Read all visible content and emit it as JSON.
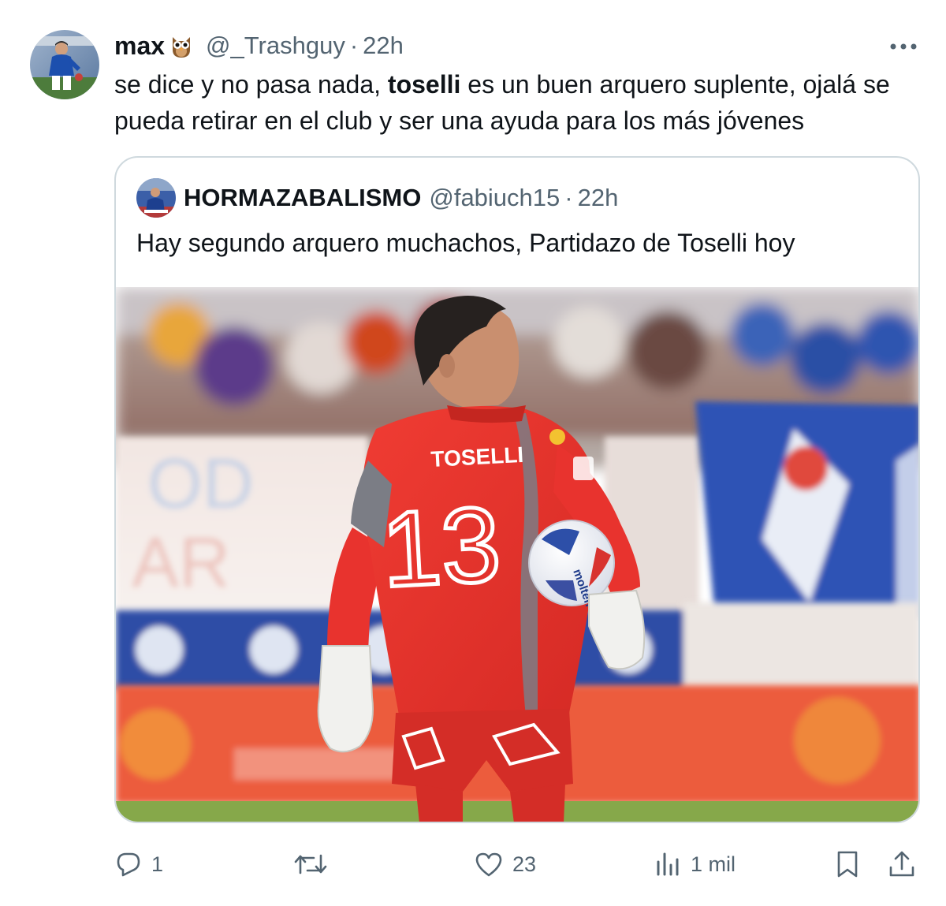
{
  "tweet": {
    "author_name": "max",
    "author_emoji": "owl-emoji",
    "handle": "@_Trashguy",
    "separator": "·",
    "time": "22h",
    "text_before": "se dice y no pasa nada, ",
    "text_bold": "toselli",
    "text_after": " es un buen arquero suplente, ojalá se pueda retirar en el club y ser una ayuda para los más jóvenes"
  },
  "quote": {
    "author_name": "HORMAZABALISMO",
    "handle": "@fabiuch15",
    "separator": "·",
    "time": "22h",
    "text": "Hay segundo arquero muchachos, Partidazo de Toselli hoy",
    "media": {
      "jersey_name": "TOSELLI",
      "jersey_number": "13",
      "ball_text": "molten"
    }
  },
  "actions": {
    "reply_count": "1",
    "retweet_count": "",
    "like_count": "23",
    "views_count": "1 mil"
  },
  "colors": {
    "text_primary": "#0f1419",
    "text_secondary": "#536471",
    "border": "#cfd9de",
    "jersey_red": "#e8332e"
  },
  "icons": {
    "more": "more-icon",
    "reply": "reply-icon",
    "retweet": "retweet-icon",
    "like": "heart-icon",
    "views": "views-icon",
    "bookmark": "bookmark-icon",
    "share": "share-icon"
  }
}
